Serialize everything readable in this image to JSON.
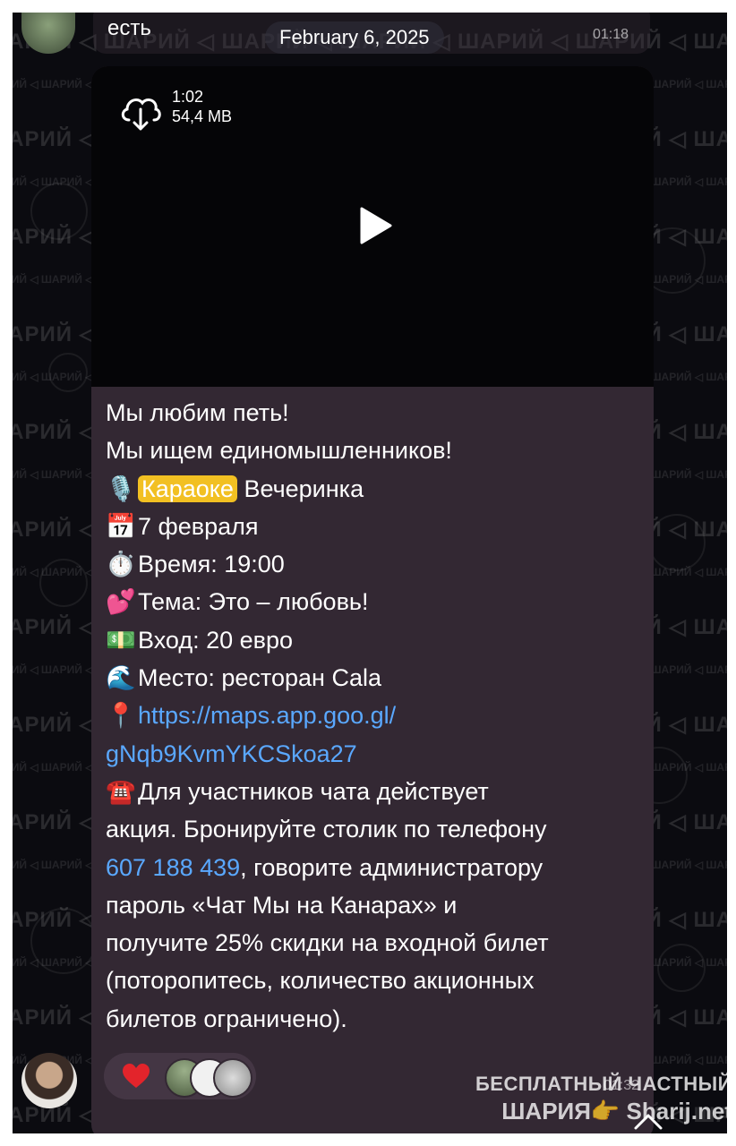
{
  "chat": {
    "date_separator": "February 6, 2025",
    "prev_message": {
      "text": "есть",
      "time": "01:18"
    },
    "video": {
      "duration": "1:02",
      "size": "54,4 MB"
    },
    "message": {
      "lines": [
        {
          "emoji": "",
          "text": "Мы любим петь!"
        },
        {
          "emoji": "",
          "text": "Мы ищем единомышленников!"
        },
        {
          "emoji": "🎙️",
          "highlight": "Караоке",
          "text": " Вечеринка"
        },
        {
          "emoji": "📅",
          "text": "7 февраля"
        },
        {
          "emoji": "⏱️",
          "text": "Время: 19:00"
        },
        {
          "emoji": "💕",
          "text": "Тема: Это – любовь!"
        },
        {
          "emoji": "💵",
          "text": "Вход: 20 евро"
        },
        {
          "emoji": "🌊",
          "text": "Место: ресторан Cala"
        },
        {
          "emoji": "📍",
          "link": "https://maps.app.goo.gl/"
        },
        {
          "emoji": "",
          "link": "gNqb9KvmYKCSkoa27"
        },
        {
          "emoji": "☎️",
          "text": "Для участников чата действует"
        },
        {
          "emoji": "",
          "text": "акция. Бронируйте столик по телефону"
        },
        {
          "emoji": "",
          "phone": "607 188 439",
          "text": ", говорите администратору"
        },
        {
          "emoji": "",
          "text": "пароль «Чат Мы на Канарах» и"
        },
        {
          "emoji": "",
          "text": "получите 25% скидки на входной билет"
        },
        {
          "emoji": "",
          "text": "(поторопитесь, количество акционных"
        },
        {
          "emoji": "",
          "text": "билетов ограничено)."
        }
      ],
      "time": "01:32",
      "reaction": "❤️"
    },
    "watermark": "ШАРИЙ"
  },
  "site_watermark": {
    "line1": "БЕСПЛАТНЫЙ ЧАСТНЫЙ",
    "line2": "ШАРИЯ👉 Sharij.net"
  },
  "colors": {
    "link": "#5aa8ff",
    "highlight": "#f2c022",
    "bubble": "#332833",
    "background": "#0b0b10"
  }
}
